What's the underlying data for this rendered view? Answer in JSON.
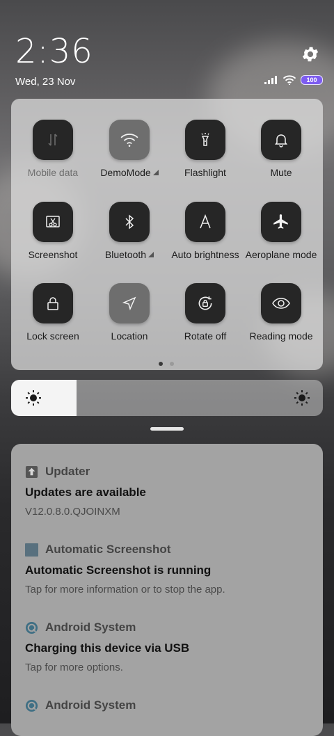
{
  "status": {
    "time": "2:36",
    "date": "Wed, 23 Nov",
    "battery": "100"
  },
  "tiles": [
    {
      "label": "Mobile data",
      "icon": "mobile-data-icon",
      "active": false,
      "dim": true
    },
    {
      "label": "DemoMode",
      "icon": "wifi-icon",
      "active": true,
      "arrow": true
    },
    {
      "label": "Flashlight",
      "icon": "flashlight-icon",
      "active": false
    },
    {
      "label": "Mute",
      "icon": "bell-icon",
      "active": false
    },
    {
      "label": "Screenshot",
      "icon": "screenshot-icon",
      "active": false
    },
    {
      "label": "Bluetooth",
      "icon": "bluetooth-icon",
      "active": false,
      "arrow": true
    },
    {
      "label": "Auto brightness",
      "icon": "auto-brightness-icon",
      "active": false
    },
    {
      "label": "Aeroplane mode",
      "icon": "airplane-icon",
      "active": false
    },
    {
      "label": "Lock screen",
      "icon": "lock-icon",
      "active": false
    },
    {
      "label": "Location",
      "icon": "location-icon",
      "active": true
    },
    {
      "label": "Rotate off",
      "icon": "rotate-lock-icon",
      "active": false
    },
    {
      "label": "Reading mode",
      "icon": "eye-icon",
      "active": false
    }
  ],
  "brightness": {
    "level": 0.21
  },
  "notifications": [
    {
      "app": "Updater",
      "title": "Updates are available",
      "text": "V12.0.8.0.QJOINXM",
      "icon": "updater-icon"
    },
    {
      "app": "Automatic Screenshot",
      "title": "Automatic Screenshot is running",
      "text": "Tap for more information or to stop the app.",
      "icon": "automatic-screenshot-icon"
    },
    {
      "app": "Android System",
      "title": "Charging this device via USB",
      "text": "Tap for more options.",
      "icon": "android-system-icon"
    },
    {
      "app": "Android System",
      "title": "",
      "text": "",
      "icon": "android-system-icon"
    }
  ]
}
